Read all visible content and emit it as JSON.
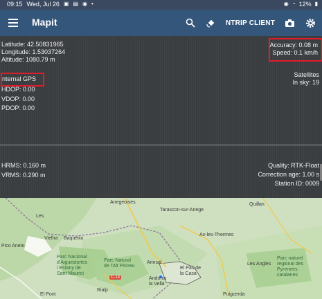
{
  "status_bar": {
    "time": "09:15",
    "date": "Wed, Jul 26",
    "battery": "12%"
  },
  "app_bar": {
    "title": "Mapit",
    "ntrip_label": "NTRIP CLIENT"
  },
  "position": {
    "latitude": "Latitude: 42.50831965",
    "longitude": "Longitude: 1.53037264",
    "altitude": "Altitude: 1080.79 m"
  },
  "accuracy": {
    "accuracy": "Accuracy: 0.08 m",
    "speed": "Speed: 0.1 km/h"
  },
  "gps": {
    "source": "nternal GPS",
    "hdop": "HDOP: 0.00",
    "vdop": "VDOP: 0.00",
    "pdop": "PDOP: 0.00"
  },
  "satellites": {
    "label": "Satellites",
    "in_sky": "In sky: 19"
  },
  "rms": {
    "hrms": "HRMS: 0.160 m",
    "vrms": "VRMS: 0.290 m"
  },
  "correction": {
    "quality": "Quality: RTK-Float",
    "age": "Correction age: 1.00 s",
    "station": "Station ID: 0009"
  },
  "map": {
    "labels": {
      "anegeoises": "Anegeoises",
      "tarascon": "Tarascon-sur-Ariege",
      "quillan": "Quillan",
      "les": "Les",
      "vielha": "Vielha",
      "baqueira": "Baqueira",
      "pico": "Pico Aneto",
      "ax": "Ax-les-Thermes",
      "pn_aiguestortes": "Parc Nacional\nd'Aiguestortes\ni Estany de\nSant Maurici",
      "parc_pirineu": "Parc Natural\nde l'Alt Pirineu",
      "arinsal": "Arinsal",
      "pas": "El Pas de\nla Casa",
      "angles": "Les Angles",
      "parc_pyrenees": "Parc naturel\nregional des\nPyrenees\ncatalanes",
      "andorra": "Andorra\nla Vella",
      "rialp": "Rialp",
      "elpont": "El Pont",
      "puigcerda": "Puigcerda",
      "road_c13": "C-13"
    }
  },
  "colors": {
    "accent_red": "#e21b2b",
    "app_bar": "#34567b",
    "panel": "#3a3d40"
  }
}
